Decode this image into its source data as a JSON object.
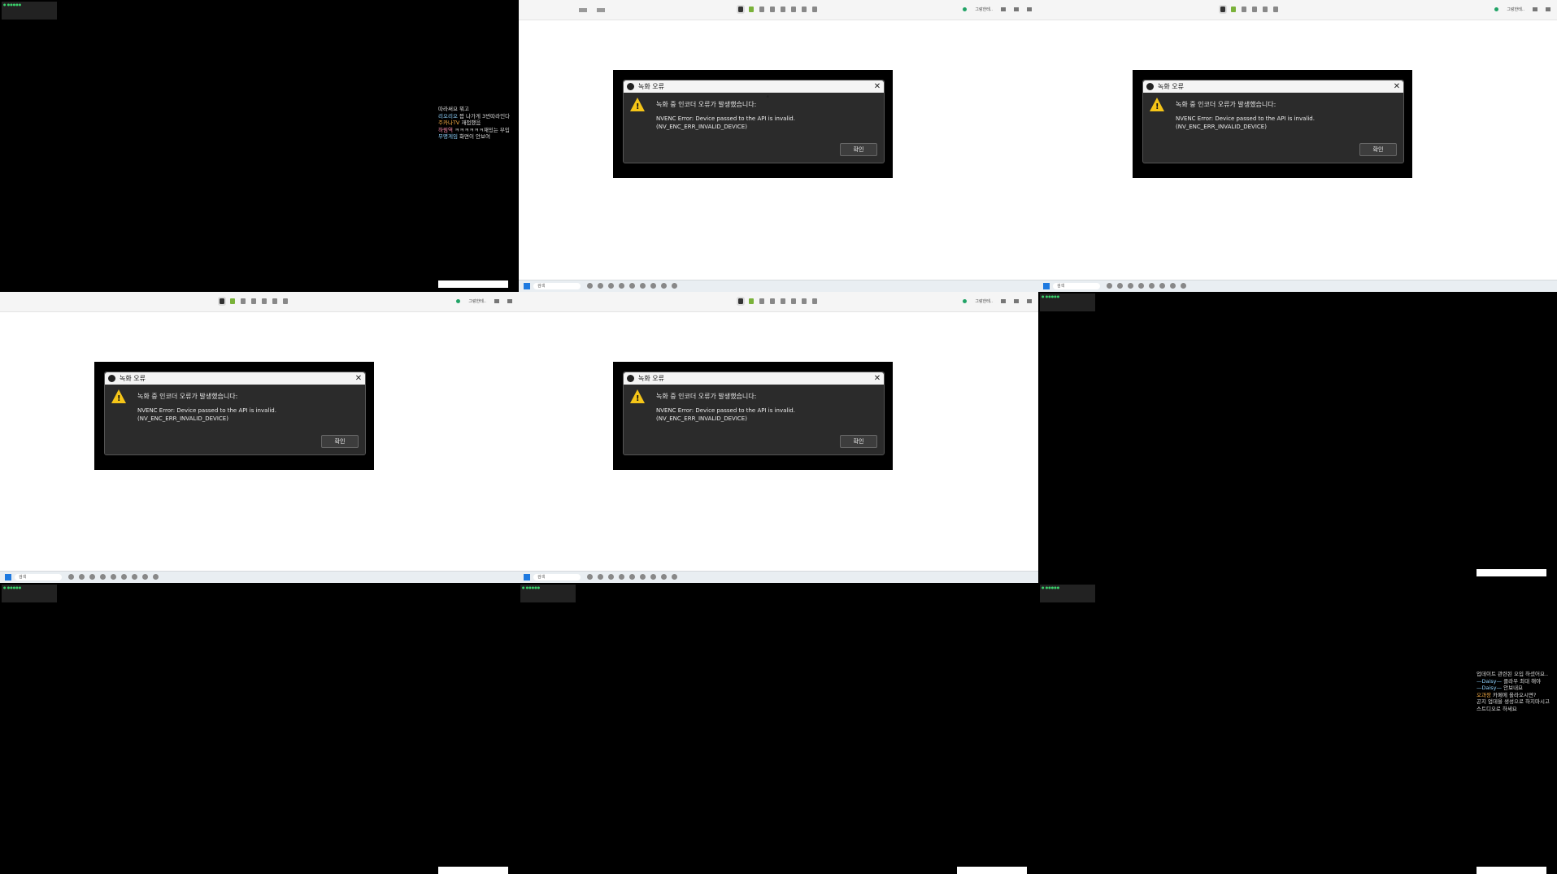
{
  "colors": {
    "dialog_bg": "#2b2b2b",
    "warning_yellow": "#f5c518",
    "app_bg_light": "#ffffff",
    "stream_bg": "#000000",
    "live_green": "#3ad16b"
  },
  "dialog": {
    "title": "녹화 오류",
    "heading": "녹화 중 인코더 오류가 발생했습니다:",
    "message_line1": "NVENC Error: Device passed to the API is invalid.",
    "message_line2": "(NV_ENC_ERR_INVALID_DEVICE)",
    "ok_label": "확인",
    "close_icon": "close-icon",
    "warning_icon": "warning-icon"
  },
  "toolbar": {
    "account_label": "그랑한테.."
  },
  "taskbar": {
    "search_placeholder": "검색"
  },
  "chats": {
    "panel1": [
      {
        "nick": "",
        "text": "따라써요 뭐고"
      },
      {
        "nick": "리오리오",
        "text": "짭 나가게 3번따라인다"
      },
      {
        "nick": "주카나TV",
        "text": "재접했음"
      },
      {
        "nick": "하림역",
        "text": "ㅋㅋㅋㅋㅋㅋ재밌는 부입"
      },
      {
        "nick": "무명게임",
        "text": "화면이 안보여"
      }
    ],
    "panel9": [
      {
        "nick": "",
        "text": "업데이트 관련된 오입 하셨어요.."
      },
      {
        "nick": "—Daisy—",
        "text": "클라우 최대 해야"
      },
      {
        "nick": "—Daisy—",
        "text": "안보내요"
      },
      {
        "nick": "오과장",
        "text": "카페에 올라오시면?"
      },
      {
        "nick": "",
        "text": "곤지 업데을 생성으로 하지마시고 스트디오로 하세요"
      }
    ]
  }
}
